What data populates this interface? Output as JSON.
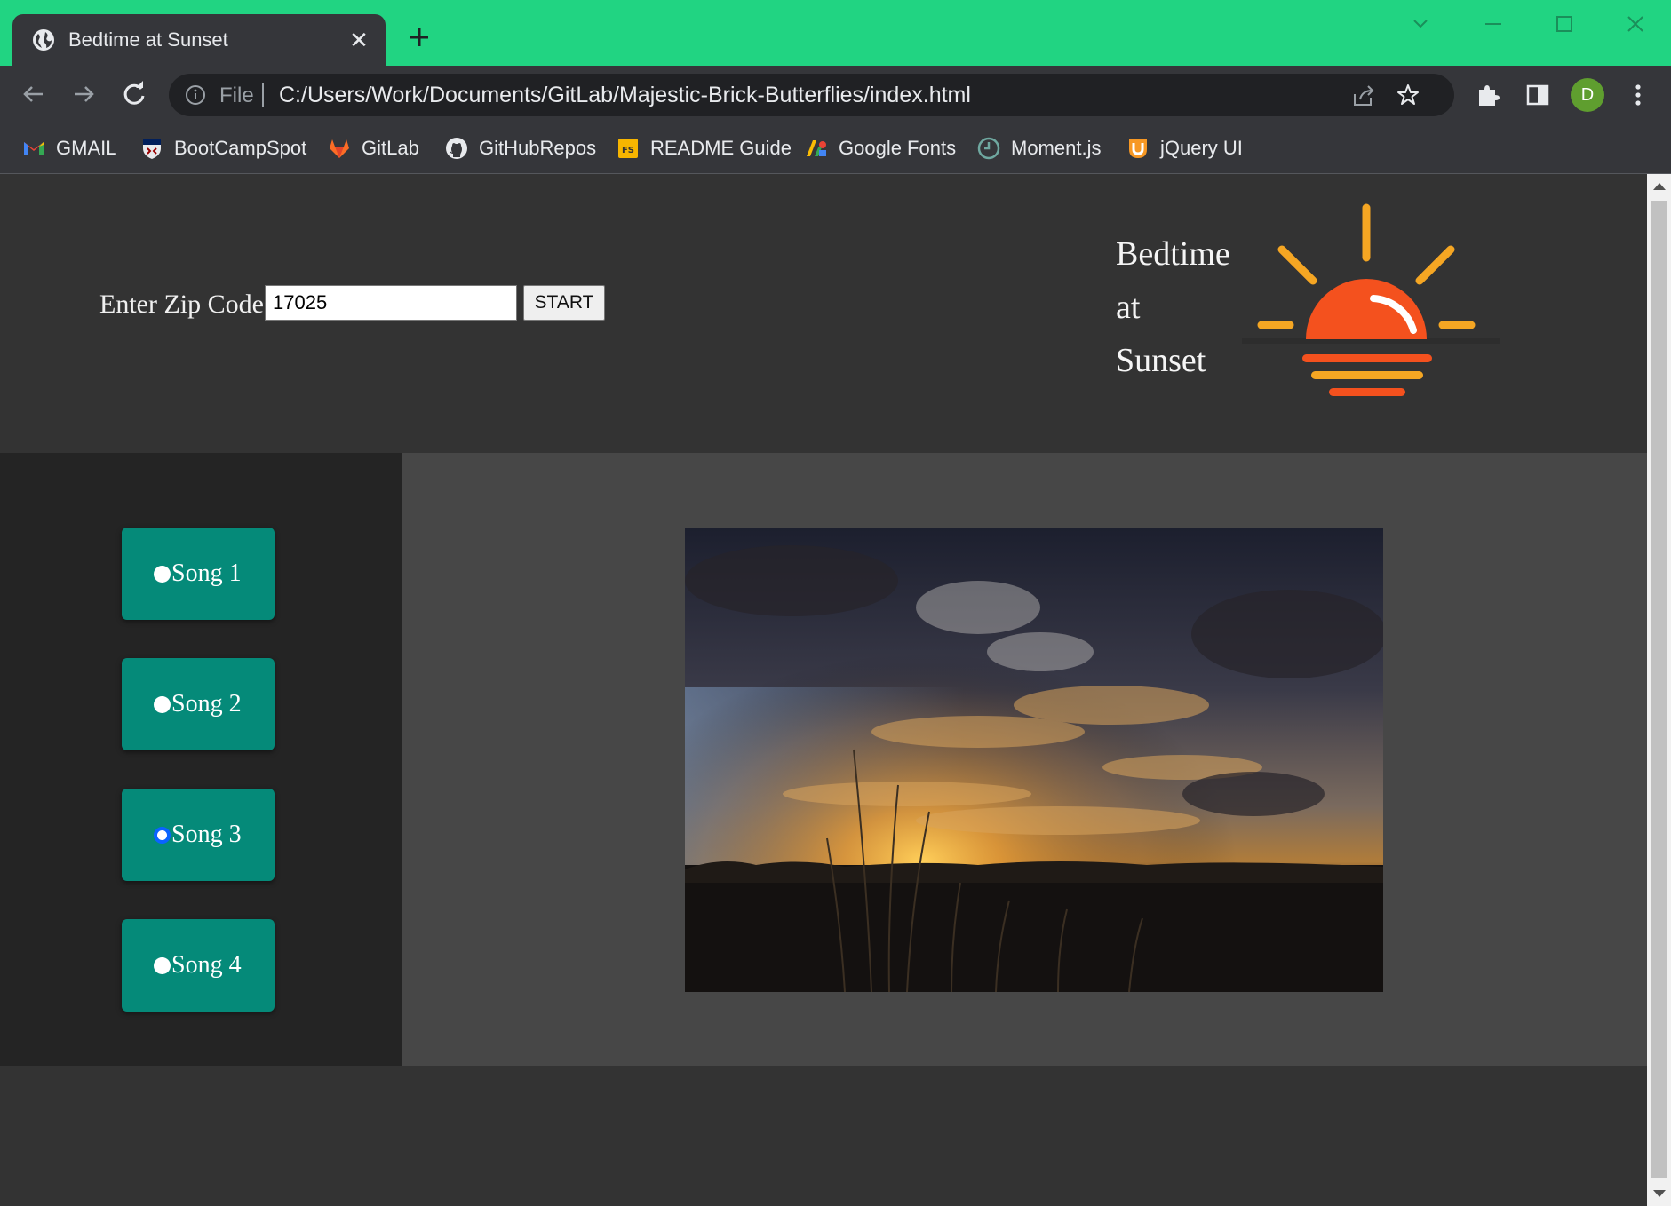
{
  "browser": {
    "tab_title": "Bedtime at Sunset",
    "tab_close": "✕",
    "omnibox_scheme": "File",
    "url": "C:/Users/Work/Documents/GitLab/Majestic-Brick-Butterflies/index.html",
    "profile_initial": "D",
    "accent_color": "#21d482"
  },
  "bookmarks": [
    {
      "label": "GMAIL",
      "icon": "gmail-icon"
    },
    {
      "label": "BootCampSpot",
      "icon": "penn-shield-icon"
    },
    {
      "label": "GitLab",
      "icon": "gitlab-icon"
    },
    {
      "label": "GitHubRepos",
      "icon": "github-icon"
    },
    {
      "label": "README Guide",
      "icon": "fs-icon"
    },
    {
      "label": "Google Fonts",
      "icon": "google-fonts-icon"
    },
    {
      "label": "Moment.js",
      "icon": "clock-icon"
    },
    {
      "label": "jQuery UI",
      "icon": "jquery-ui-icon"
    }
  ],
  "header": {
    "zip_label": "Enter Zip Code:",
    "zip_value": "17025",
    "start_label": "START",
    "brand_lines": [
      "Bedtime",
      "at",
      "Sunset"
    ]
  },
  "songs": [
    {
      "label": "Song 1",
      "checked": false
    },
    {
      "label": "Song 2",
      "checked": false
    },
    {
      "label": "Song 3",
      "checked": true
    },
    {
      "label": "Song 4",
      "checked": false
    }
  ],
  "colors": {
    "song_button": "#058a79",
    "sun_orange": "#f4511e",
    "sun_rays": "#f5a623"
  }
}
